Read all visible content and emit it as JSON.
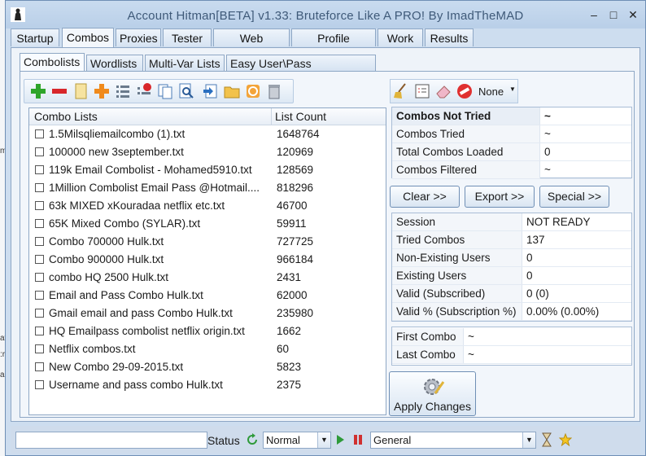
{
  "window": {
    "title": "Account Hitman[BETA] v1.33: Bruteforce Like A PRO!  By ImadTheMAD"
  },
  "main_tabs": [
    "Startup",
    "Combos",
    "Proxies",
    "Tester",
    "Web Analyzer",
    "Profile Settings",
    "Work",
    "Results"
  ],
  "sub_tabs": [
    "Combolists",
    "Wordlists",
    "Multi-Var Lists",
    "Easy User\\Pass Manipulation"
  ],
  "combo_list": {
    "col_name": "Combo Lists",
    "col_count": "List Count",
    "rows": [
      {
        "name": "1.5Milsqliemailcombo (1).txt",
        "count": "1648764"
      },
      {
        "name": "100000 new 3september.txt",
        "count": "120969"
      },
      {
        "name": "119k Email Combolist - Mohamed5910.txt",
        "count": "128569"
      },
      {
        "name": "1Million Combolist Email Pass @Hotmail....",
        "count": "818296"
      },
      {
        "name": "63k MIXED xKouradaa netflix etc.txt",
        "count": "46700"
      },
      {
        "name": "65K Mixed Combo (SYLAR).txt",
        "count": "59911"
      },
      {
        "name": "Combo 700000 Hulk.txt",
        "count": "727725"
      },
      {
        "name": "Combo 900000 Hulk.txt",
        "count": "966184"
      },
      {
        "name": "combo HQ 2500 Hulk.txt",
        "count": "2431"
      },
      {
        "name": "Email and Pass Combo Hulk.txt",
        "count": "62000"
      },
      {
        "name": "Gmail email and pass Combo Hulk.txt",
        "count": "235980"
      },
      {
        "name": "HQ Emailpass combolist netflix origin.txt",
        "count": "1662"
      },
      {
        "name": "Netflix combos.txt",
        "count": "60"
      },
      {
        "name": "New Combo 29-09-2015.txt",
        "count": "5823"
      },
      {
        "name": "Username and pass combo Hulk.txt",
        "count": "2375"
      }
    ]
  },
  "filter": {
    "selected": "None"
  },
  "stats1": [
    {
      "k": "Combos Not Tried",
      "v": "~"
    },
    {
      "k": "Combos Tried",
      "v": "~"
    },
    {
      "k": "Total Combos Loaded",
      "v": "0"
    },
    {
      "k": "Combos Filtered",
      "v": "~"
    }
  ],
  "buttons": {
    "clear": "Clear >>",
    "export": "Export >>",
    "special": "Special >>",
    "apply": "Apply Changes"
  },
  "stats2": [
    {
      "k": "Session",
      "v": "NOT READY"
    },
    {
      "k": "Tried Combos",
      "v": "137"
    },
    {
      "k": "Non-Existing Users",
      "v": "0"
    },
    {
      "k": "Existing Users",
      "v": "0"
    },
    {
      "k": "Valid (Subscribed)",
      "v": "0 (0)"
    },
    {
      "k": "Valid % (Subscription %)",
      "v": "0.00% (0.00%)"
    }
  ],
  "stats3": [
    {
      "k": "First Combo",
      "v": "~"
    },
    {
      "k": "Last Combo",
      "v": "~"
    }
  ],
  "statusbar": {
    "label": "Status",
    "mode": "Normal",
    "category": "General"
  }
}
